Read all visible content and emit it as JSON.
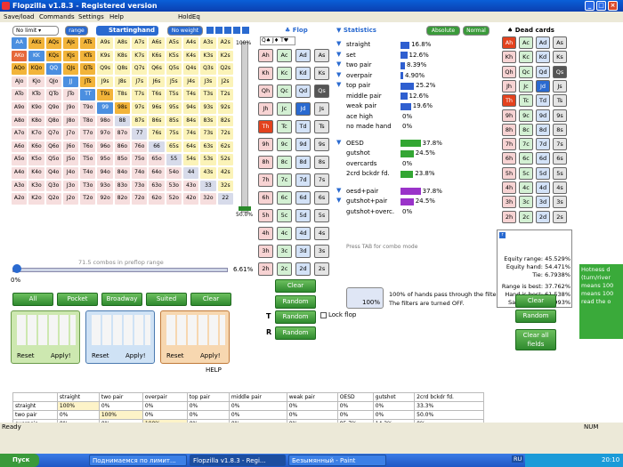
{
  "title": "Flopzilla v1.8.3 - Registered version",
  "menu": [
    "Save/load",
    "Commands",
    "Settings",
    "Help",
    "HoldEq"
  ],
  "controls": {
    "limit": "No limit",
    "range_btn": "range",
    "starting_hand": "Startinghand",
    "no_weight": "No weight",
    "flop_hdr": "Flop",
    "stats_hdr": "Statistics",
    "absolute": "Absolute",
    "normal": "Normal",
    "dead_hdr": "Dead cards",
    "pct_top": "100%",
    "pct_mid": "50.0%",
    "slider_left": "0%",
    "slider_right": "6.61%",
    "combos": "71.5 combos in preflop range"
  },
  "grid": [
    [
      "AA",
      "AKs",
      "AQs",
      "AJs",
      "ATs",
      "A9s",
      "A8s",
      "A7s",
      "A6s",
      "A5s",
      "A4s",
      "A3s",
      "A2s"
    ],
    [
      "AKo",
      "KK",
      "KQs",
      "KJs",
      "KTs",
      "K9s",
      "K8s",
      "K7s",
      "K6s",
      "K5s",
      "K4s",
      "K3s",
      "K2s"
    ],
    [
      "AQo",
      "KQo",
      "QQ",
      "QJs",
      "QTs",
      "Q9s",
      "Q8s",
      "Q7s",
      "Q6s",
      "Q5s",
      "Q4s",
      "Q3s",
      "Q2s"
    ],
    [
      "AJo",
      "KJo",
      "QJo",
      "JJ",
      "JTs",
      "J9s",
      "J8s",
      "J7s",
      "J6s",
      "J5s",
      "J4s",
      "J3s",
      "J2s"
    ],
    [
      "ATo",
      "KTo",
      "QTo",
      "JTo",
      "TT",
      "T9s",
      "T8s",
      "T7s",
      "T6s",
      "T5s",
      "T4s",
      "T3s",
      "T2s"
    ],
    [
      "A9o",
      "K9o",
      "Q9o",
      "J9o",
      "T9o",
      "99",
      "98s",
      "97s",
      "96s",
      "95s",
      "94s",
      "93s",
      "92s"
    ],
    [
      "A8o",
      "K8o",
      "Q8o",
      "J8o",
      "T8o",
      "98o",
      "88",
      "87s",
      "86s",
      "85s",
      "84s",
      "83s",
      "82s"
    ],
    [
      "A7o",
      "K7o",
      "Q7o",
      "J7o",
      "T7o",
      "97o",
      "87o",
      "77",
      "76s",
      "75s",
      "74s",
      "73s",
      "72s"
    ],
    [
      "A6o",
      "K6o",
      "Q6o",
      "J6o",
      "T6o",
      "96o",
      "86o",
      "76o",
      "66",
      "65s",
      "64s",
      "63s",
      "62s"
    ],
    [
      "A5o",
      "K5o",
      "Q5o",
      "J5o",
      "T5o",
      "95o",
      "85o",
      "75o",
      "65o",
      "55",
      "54s",
      "53s",
      "52s"
    ],
    [
      "A4o",
      "K4o",
      "Q4o",
      "J4o",
      "T4o",
      "94o",
      "84o",
      "74o",
      "64o",
      "54o",
      "44",
      "43s",
      "42s"
    ],
    [
      "A3o",
      "K3o",
      "Q3o",
      "J3o",
      "T3o",
      "93o",
      "83o",
      "73o",
      "63o",
      "53o",
      "43o",
      "33",
      "32s"
    ],
    [
      "A2o",
      "K2o",
      "Q2o",
      "J2o",
      "T2o",
      "92o",
      "82o",
      "72o",
      "62o",
      "52o",
      "42o",
      "32o",
      "22"
    ]
  ],
  "selected": [
    "AKs",
    "AQs",
    "AJs",
    "ATs",
    "KQs",
    "KJs",
    "KTs",
    "QJs",
    "QTs",
    "JTs",
    "T9s",
    "98s",
    "AQo",
    "KQo"
  ],
  "selected_pairs": [
    "AA",
    "KK",
    "QQ",
    "JJ",
    "TT",
    "99"
  ],
  "selected_off": [
    "AKo"
  ],
  "range_buttons": [
    "All",
    "Pocket",
    "Broadway",
    "Suited",
    "Clear"
  ],
  "reset": "Reset",
  "apply": "Apply!",
  "help": "HELP",
  "flop_cols": [
    "h",
    "c",
    "d",
    "s"
  ],
  "ranks": [
    "A",
    "K",
    "Q",
    "J",
    "T",
    "9",
    "8",
    "7",
    "6",
    "5",
    "4",
    "3",
    "2"
  ],
  "flop_selected": [
    "Qs",
    "Jd",
    "Th"
  ],
  "flop_slots": [
    "Q",
    "J",
    "T"
  ],
  "flop_buttons": {
    "clear": "Clear",
    "random1": "Random",
    "random2": "Random",
    "random3": "Random",
    "lock": "Lock flop",
    "t": "T",
    "r": "R"
  },
  "stats": [
    {
      "label": "straight",
      "val": "16.8%",
      "w": 16.8,
      "c": "b",
      "f": 1
    },
    {
      "label": "set",
      "val": "12.6%",
      "w": 12.6,
      "c": "b",
      "f": 1
    },
    {
      "label": "two pair",
      "val": "8.39%",
      "w": 8.39,
      "c": "b",
      "f": 1
    },
    {
      "label": "overpair",
      "val": "4.90%",
      "w": 4.9,
      "c": "b",
      "f": 1
    },
    {
      "label": "top pair",
      "val": "25.2%",
      "w": 25.2,
      "c": "b",
      "f": 1
    },
    {
      "label": "middle pair",
      "val": "12.6%",
      "w": 12.6,
      "c": "b",
      "f": 0
    },
    {
      "label": "weak pair",
      "val": "19.6%",
      "w": 19.6,
      "c": "b",
      "f": 0
    },
    {
      "label": "ace high",
      "val": "0%",
      "w": 0,
      "c": "b",
      "f": 0
    },
    {
      "label": "no made hand",
      "val": "0%",
      "w": 0,
      "c": "b",
      "f": 0
    }
  ],
  "draws": [
    {
      "label": "OESD",
      "val": "37.8%",
      "w": 37.8,
      "c": "g",
      "f": 1
    },
    {
      "label": "gutshot",
      "val": "24.5%",
      "w": 24.5,
      "c": "g",
      "f": 0
    },
    {
      "label": "overcards",
      "val": "0%",
      "w": 0,
      "c": "g",
      "f": 0
    },
    {
      "label": "2crd bckdr fd.",
      "val": "23.8%",
      "w": 23.8,
      "c": "g",
      "f": 0
    }
  ],
  "combos2": [
    {
      "label": "oesd+pair",
      "val": "37.8%",
      "w": 37.8,
      "c": "p",
      "f": 1
    },
    {
      "label": "gutshot+pair",
      "val": "24.5%",
      "w": 24.5,
      "c": "p",
      "f": 1
    },
    {
      "label": "gutshot+overc.",
      "val": "0%",
      "w": 0,
      "c": "p",
      "f": 0
    }
  ],
  "tab_hint": "Press TAB for combo mode",
  "filter": {
    "pct": "100%",
    "line1": "100% of hands pass through the filters.",
    "line2": "The filters are turned OFF."
  },
  "dead": {
    "ranks": [
      "A",
      "K",
      "Q",
      "J",
      "T",
      "9",
      "8",
      "7",
      "6",
      "5",
      "4",
      "3",
      "2"
    ],
    "marked": [
      "Ah",
      "Qs",
      "Jd",
      "Th"
    ],
    "clear": "Clear",
    "random": "Random",
    "clear_all": "Clear all fields"
  },
  "equity": {
    "range": "Equity range: 45.529%",
    "hand": "Equity hand: 54.471%",
    "tie": "Tie: 6.7938%",
    "best": "Range is best: 37.762%",
    "hbest": "Hand is best: 61.538%",
    "same": "Same hand: 0.6993%",
    "sidebar": "r"
  },
  "hotness": [
    "Hotness d",
    "(turn/river",
    "means 100",
    "means 100",
    "read the o"
  ],
  "table": {
    "headers": [
      "",
      "straight",
      "two pair",
      "overpair",
      "top pair",
      "middle pair",
      "weak pair",
      "OESD",
      "gutshot",
      "2crd bckdr fd."
    ],
    "rows": [
      [
        "straight",
        "100%",
        "0%",
        "0%",
        "0%",
        "0%",
        "0%",
        "0%",
        "0%",
        "33.3%"
      ],
      [
        "two pair",
        "0%",
        "100%",
        "0%",
        "0%",
        "0%",
        "0%",
        "0%",
        "0%",
        "50.0%"
      ],
      [
        "overpair",
        "0%",
        "0%",
        "100%",
        "0%",
        "0%",
        "0%",
        "85.7%",
        "14.3%",
        "0%"
      ]
    ]
  },
  "status": {
    "ready": "Ready",
    "num": "NUM"
  },
  "taskbar": {
    "start": "Пуск",
    "t1": "Поднимаемся по лимит...",
    "t2": "Flopzilla v1.8.3 - Regi...",
    "t3": "Безымянный - Paint",
    "lang": "RU",
    "clock": "20:10"
  }
}
